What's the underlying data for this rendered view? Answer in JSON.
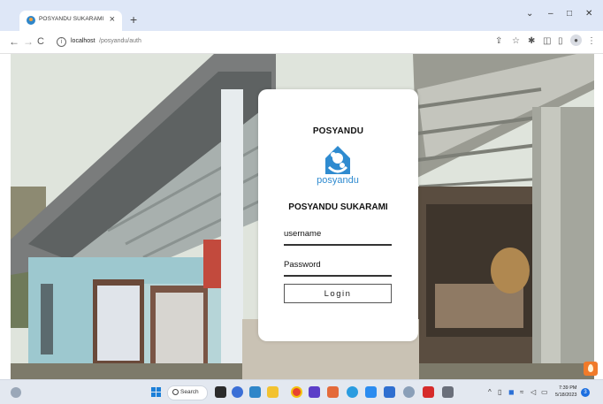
{
  "browser": {
    "tab": {
      "title": "POSYANDU SUKARAMI",
      "close_glyph": "×"
    },
    "new_tab_glyph": "+",
    "window_controls": {
      "collapse": "⌄",
      "minimize": "–",
      "maximize": "□",
      "close": "✕"
    },
    "nav": {
      "back": "←",
      "forward": "→",
      "reload": "C"
    },
    "address": {
      "host": "localhost",
      "path": "/posyandu/auth"
    },
    "toolbar_icons": [
      "share-icon",
      "star-icon",
      "extensions-icon",
      "sidepanel-icon",
      "profile-icon",
      "menu-icon"
    ]
  },
  "login": {
    "heading": "POSYANDU",
    "logo_text": "posyandu",
    "org_name": "POSYANDU SUKARAMI",
    "username_label": "username",
    "password_label": "Password",
    "login_label": "Login"
  },
  "taskbar": {
    "search_label": "Search",
    "clock_time": "7:39 PM",
    "clock_date": "5/18/2023",
    "notification_count": "3"
  },
  "colors": {
    "accent_blue": "#2f8bd0",
    "taskbar_bg": "#e3e8f0",
    "tabstrip_bg": "#dee7f7"
  }
}
